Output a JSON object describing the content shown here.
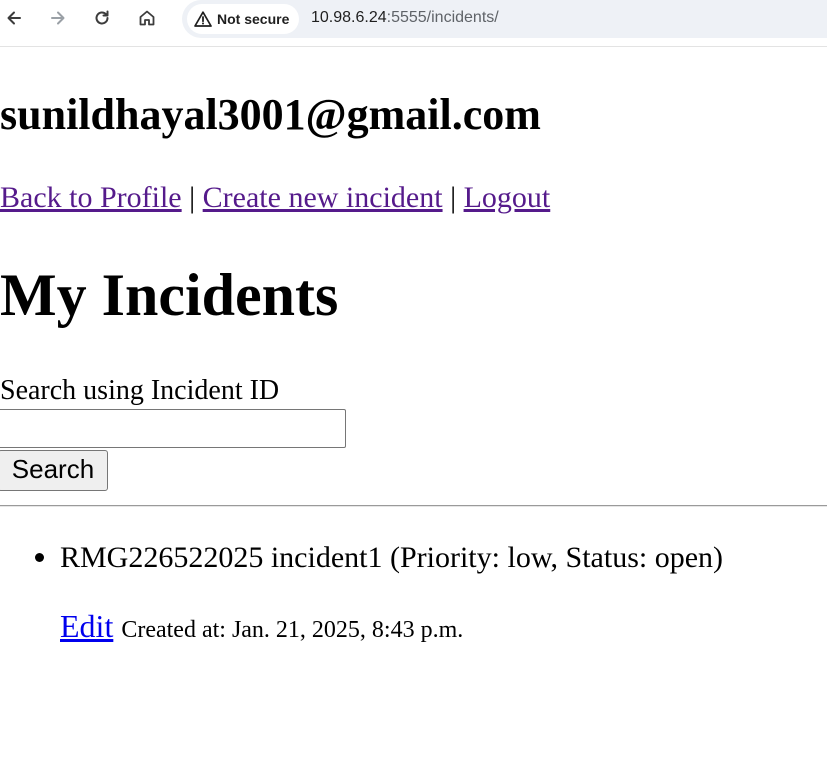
{
  "browser": {
    "security_label": "Not secure",
    "url_host": "10.98.6.24",
    "url_rest": ":5555/incidents/"
  },
  "header": {
    "user_email": "sunildhayal3001@gmail.com"
  },
  "nav": {
    "back_to_profile": "Back to Profile",
    "separator_1": "|",
    "create_incident": "Create new incident",
    "separator_2": "|",
    "logout": "Logout"
  },
  "main": {
    "title": "My Incidents",
    "search": {
      "label": "Search using Incident ID",
      "input_value": "",
      "button_label": "Search"
    },
    "incidents": [
      {
        "summary": "RMG226522025 incident1 (Priority: low, Status: open)",
        "edit_label": "Edit",
        "created": "Created at: Jan. 21, 2025, 8:43 p.m."
      }
    ]
  }
}
